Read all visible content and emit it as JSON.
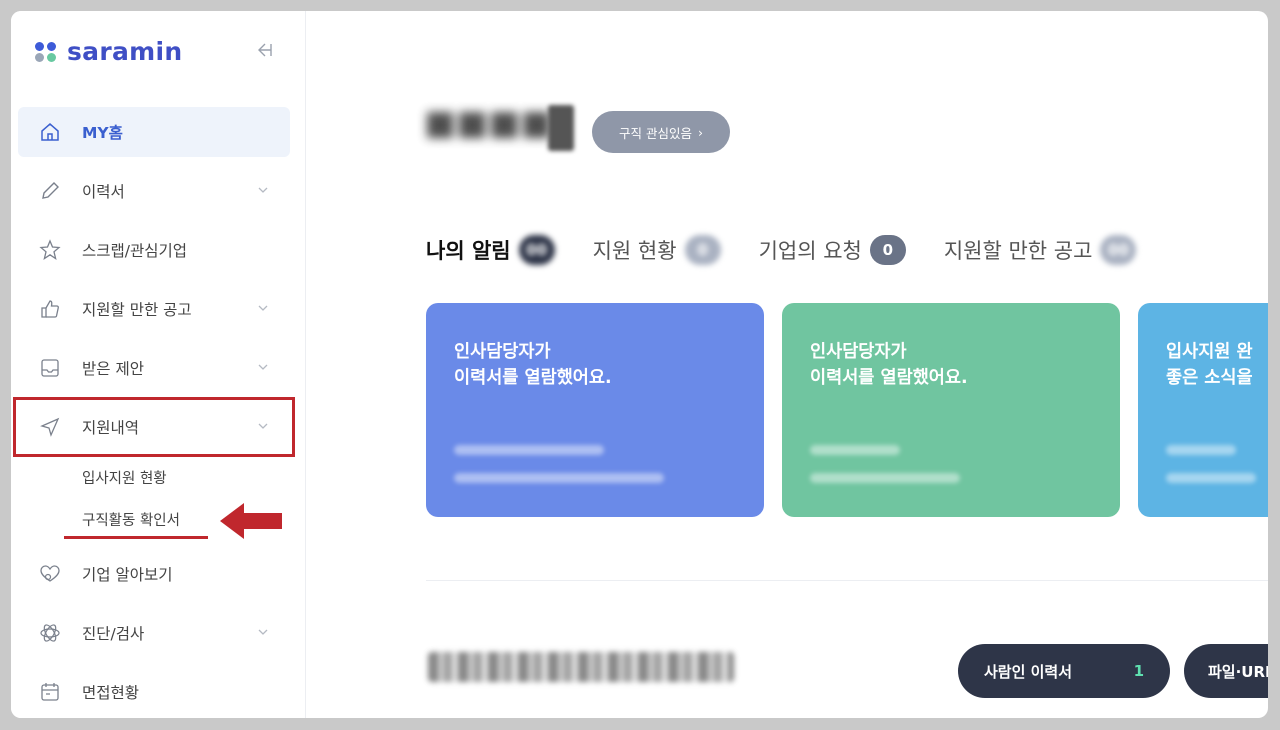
{
  "brand": {
    "name": "saramin"
  },
  "sidebar": {
    "items": [
      {
        "label": "MY홈",
        "icon": "home-icon",
        "active": true,
        "chevron": false
      },
      {
        "label": "이력서",
        "icon": "pencil-icon",
        "chevron": true
      },
      {
        "label": "스크랩/관심기업",
        "icon": "star-icon",
        "chevron": false
      },
      {
        "label": "지원할 만한 공고",
        "icon": "thumbs-up-icon",
        "chevron": true
      },
      {
        "label": "받은 제안",
        "icon": "inbox-icon",
        "chevron": true
      },
      {
        "label": "지원내역",
        "icon": "send-icon",
        "chevron": true
      }
    ],
    "subitems": [
      {
        "label": "입사지원 현황"
      },
      {
        "label": "구직활동 확인서"
      }
    ],
    "items_after": [
      {
        "label": "기업 알아보기",
        "icon": "heart-search-icon",
        "chevron": false
      },
      {
        "label": "진단/검사",
        "icon": "atom-icon",
        "chevron": true
      },
      {
        "label": "면접현황",
        "icon": "calendar-icon",
        "chevron": false
      }
    ]
  },
  "profile": {
    "status_label": "구직 관심있음"
  },
  "tabs": [
    {
      "label": "나의 알림",
      "badge": ""
    },
    {
      "label": "지원 현황",
      "badge": ""
    },
    {
      "label": "기업의 요청",
      "badge": "0"
    },
    {
      "label": "지원할 만한 공고",
      "badge": ""
    }
  ],
  "cards": [
    {
      "title": "인사담당자가\n이력서를 열람했어요.",
      "color": "#6a8ae8"
    },
    {
      "title": "인사담당자가\n이력서를 열람했어요.",
      "color": "#70c5a0"
    },
    {
      "title": "입사지원 완\n좋은 소식을",
      "color": "#5db4e4"
    }
  ],
  "resume_buttons": {
    "saramin_resume_label": "사람인 이력서",
    "saramin_resume_count": "1",
    "file_label": "파일·URL"
  },
  "colors": {
    "brand": "#3f4fc5",
    "active_nav": "#3a5fcf",
    "annotation": "#c0272d",
    "dark_pill": "#2e3548"
  }
}
